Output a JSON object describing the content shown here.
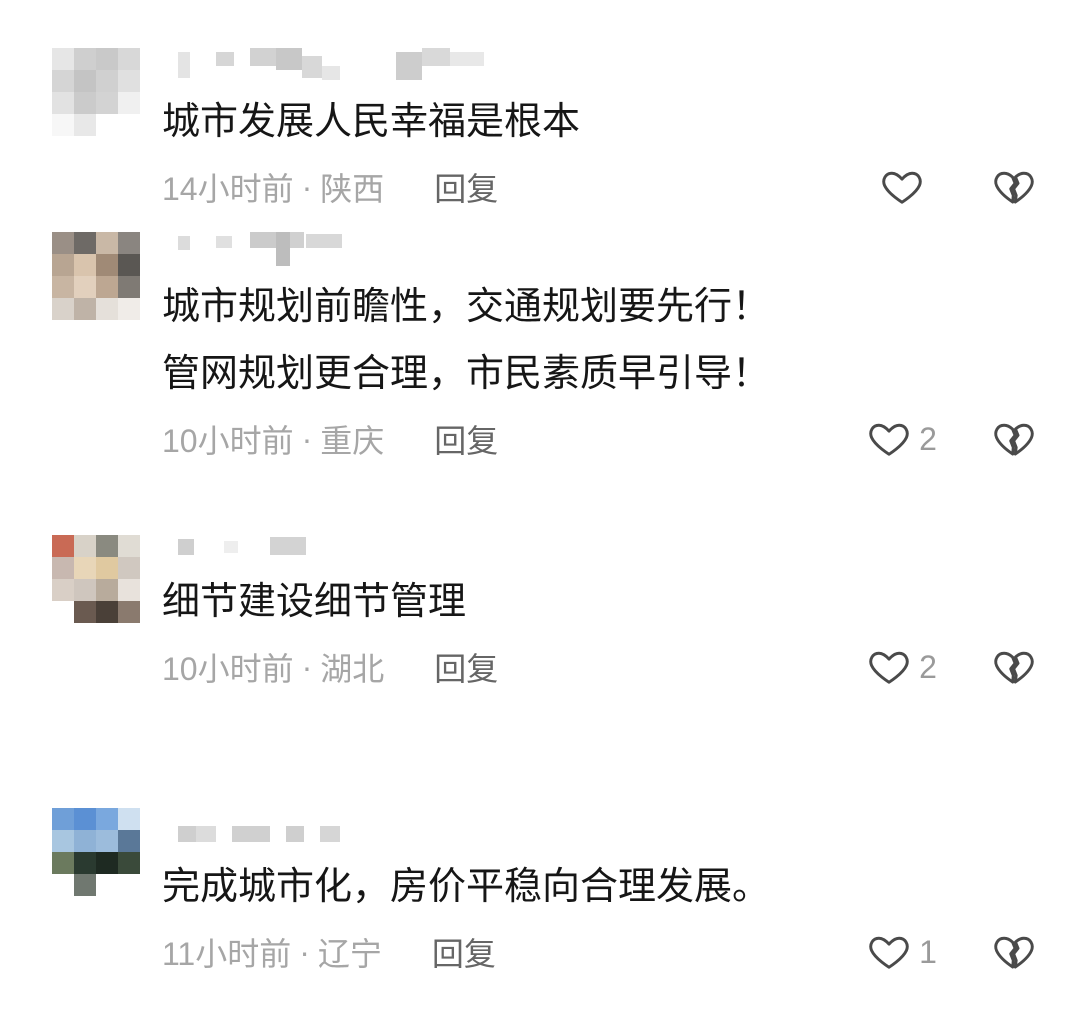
{
  "colors": {
    "text": "#161616",
    "meta": "#a6a6a6",
    "reply": "#666666",
    "icon": "#4a4a4a",
    "count": "#9a9a9a",
    "background": "#ffffff"
  },
  "icons": {
    "like": "heart-outline-icon",
    "dislike": "broken-heart-icon"
  },
  "comments": [
    {
      "text_lines": [
        "城市发展人民幸福是根本"
      ],
      "time": "14小时前",
      "separator": "·",
      "location": "陕西",
      "reply_label": "回复",
      "avatar_mosaic": [
        "#e6e6e6",
        "#cfcfcf",
        "#c9c9c9",
        "#d8d8d8",
        "#d5d5d5",
        "#c4c4c4",
        "#d0d0d0",
        "#e0e0e0",
        "#e2e2e2",
        "#cbcbcb",
        "#d3d3d3",
        "#f0f0f0",
        "#f7f7f7",
        "#e8e8e8",
        "#ffffff",
        "#ffffff"
      ]
    },
    {
      "text_lines": [
        "城市规划前瞻性，交通规划要先行！",
        "管网规划更合理，市民素质早引导！"
      ],
      "time": "10小时前",
      "separator": "·",
      "location": "重庆",
      "reply_label": "回复",
      "like_count": "2",
      "avatar_mosaic": [
        "#9a8f86",
        "#6e6a66",
        "#c9b8a6",
        "#8a8580",
        "#b8a592",
        "#d9c4ad",
        "#a08a76",
        "#5a5753",
        "#c8b5a2",
        "#e2d0bd",
        "#bda792",
        "#7f7a74",
        "#d9d2ca",
        "#bfb3a7",
        "#e5e0da",
        "#f0ece8"
      ]
    },
    {
      "text_lines": [
        "细节建设细节管理"
      ],
      "time": "10小时前",
      "separator": "·",
      "location": "湖北",
      "reply_label": "回复",
      "like_count": "2",
      "avatar_mosaic": [
        "#c96a55",
        "#d8d2c8",
        "#8a8a80",
        "#e0dcd4",
        "#c8b8b0",
        "#e8d6b8",
        "#e0c9a0",
        "#d0c8c0",
        "#d9cfc6",
        "#cfc6be",
        "#b8ab9c",
        "#e8e2dc",
        "#ffffff",
        "#6a5a50",
        "#4a4038",
        "#8a7a6e"
      ]
    },
    {
      "text_lines": [
        "完成城市化，房价平稳向合理发展。"
      ],
      "time": "11小时前",
      "separator": "·",
      "location": "辽宁",
      "reply_label": "回复",
      "like_count": "1",
      "avatar_mosaic": [
        "#6f9fd8",
        "#5b90d4",
        "#7aa8de",
        "#cfe0f0",
        "#a8c6e0",
        "#8fb2d6",
        "#9cbcdc",
        "#5a7898",
        "#6b7a5e",
        "#2a3a30",
        "#1e2a22",
        "#3a4a3a",
        "#ffffff",
        "#707870",
        "#ffffff",
        "#ffffff"
      ]
    }
  ]
}
